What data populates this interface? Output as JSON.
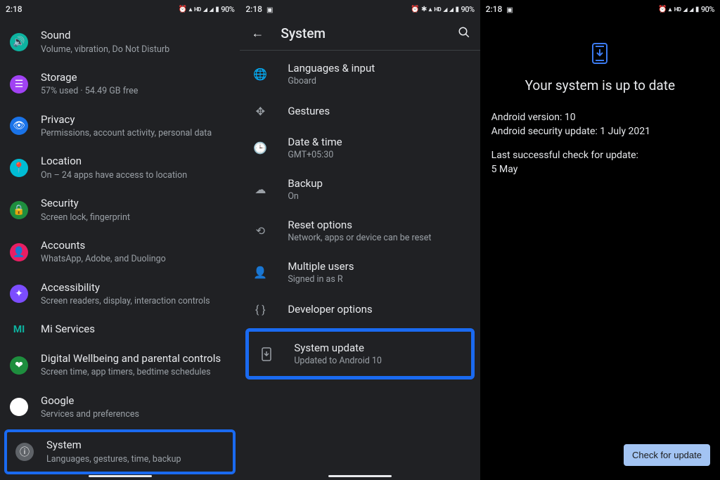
{
  "status": {
    "time": "2:18",
    "hd": "HD",
    "battery": "90%"
  },
  "panel1": {
    "items": [
      {
        "title": "Sound",
        "sub": "Volume, vibration, Do Not Disturb"
      },
      {
        "title": "Storage",
        "sub": "57% used · 54.49 GB free"
      },
      {
        "title": "Privacy",
        "sub": "Permissions, account activity, personal data"
      },
      {
        "title": "Location",
        "sub": "On – 24 apps have access to location"
      },
      {
        "title": "Security",
        "sub": "Screen lock, fingerprint"
      },
      {
        "title": "Accounts",
        "sub": "WhatsApp, Adobe, and Duolingo"
      },
      {
        "title": "Accessibility",
        "sub": "Screen readers, display, interaction controls"
      },
      {
        "title": "Mi Services",
        "sub": ""
      },
      {
        "title": "Digital Wellbeing and parental controls",
        "sub": "Screen time, app timers, bedtime schedules"
      },
      {
        "title": "Google",
        "sub": "Services and preferences"
      },
      {
        "title": "System",
        "sub": "Languages, gestures, time, backup"
      }
    ]
  },
  "panel2": {
    "header_title": "System",
    "items": [
      {
        "title": "Languages & input",
        "sub": "Gboard"
      },
      {
        "title": "Gestures",
        "sub": ""
      },
      {
        "title": "Date & time",
        "sub": "GMT+05:30"
      },
      {
        "title": "Backup",
        "sub": "On"
      },
      {
        "title": "Reset options",
        "sub": "Network, apps or device can be reset"
      },
      {
        "title": "Multiple users",
        "sub": "Signed in as R"
      },
      {
        "title": "Developer options",
        "sub": ""
      },
      {
        "title": "System update",
        "sub": "Updated to Android 10"
      }
    ]
  },
  "panel3": {
    "title": "Your system is up to date",
    "version_line": "Android version: 10",
    "security_line": "Android security update: 1 July 2021",
    "last_check_label": "Last successful check for update:",
    "last_check_value": "5 May",
    "button": "Check for update"
  }
}
